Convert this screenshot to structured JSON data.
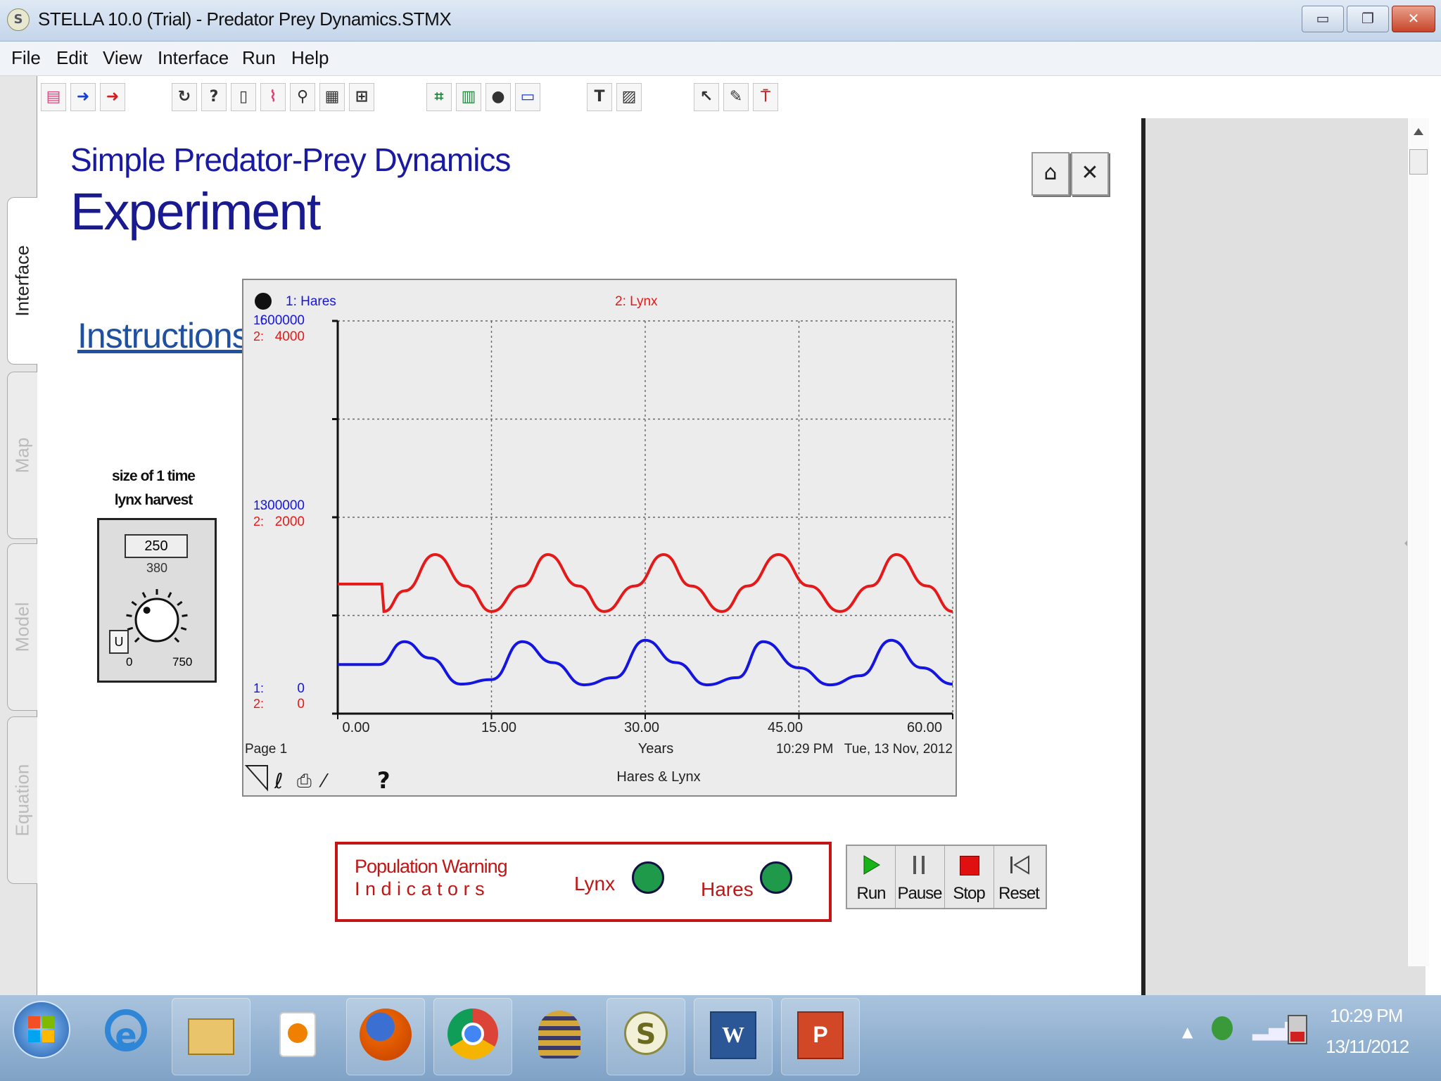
{
  "window": {
    "title": "STELLA 10.0 (Trial) - Predator Prey Dynamics.STMX",
    "app_icon": "S"
  },
  "menu": [
    "File",
    "Edit",
    "View",
    "Interface",
    "Run",
    "Help"
  ],
  "side_tabs": [
    "Interface",
    "Map",
    "Model",
    "Equation"
  ],
  "page": {
    "subtitle": "Simple Predator-Prey Dynamics",
    "title": "Experiment",
    "instructions_link": "Instructions"
  },
  "knob": {
    "label_line1": "size of 1 time",
    "label_line2": "lynx harvest",
    "display_value": "250",
    "dial_value": "380",
    "min": "0",
    "max": "750",
    "unit_button": "U",
    "level_fraction": 0.33
  },
  "chart_data": {
    "type": "line",
    "series_labels": [
      "1: Hares",
      "2: Lynx"
    ],
    "series": [
      {
        "name": "1: Hares",
        "color": "#1515e0",
        "axis_ticks": [
          "600000",
          "300000",
          "0"
        ],
        "ylim": [
          0,
          600000
        ],
        "points": [
          [
            0,
            75000
          ],
          [
            4,
            75000
          ],
          [
            6.5,
            110000
          ],
          [
            9,
            85000
          ],
          [
            12,
            45000
          ],
          [
            15,
            52000
          ],
          [
            18,
            110000
          ],
          [
            21,
            78000
          ],
          [
            24,
            44000
          ],
          [
            27,
            55000
          ],
          [
            30,
            112000
          ],
          [
            33,
            78000
          ],
          [
            36,
            44000
          ],
          [
            39,
            55000
          ],
          [
            41.5,
            110000
          ],
          [
            45,
            70000
          ],
          [
            48,
            44000
          ],
          [
            51,
            58000
          ],
          [
            54,
            112000
          ],
          [
            57,
            70000
          ],
          [
            60,
            45000
          ]
        ]
      },
      {
        "name": "2: Lynx",
        "color": "#e41a1a",
        "axis_ticks": [
          "4000",
          "2000",
          "0"
        ],
        "ylim": [
          0,
          4000
        ],
        "points": [
          [
            0,
            1320
          ],
          [
            4.3,
            1320
          ],
          [
            4.5,
            1040
          ],
          [
            6.5,
            1250
          ],
          [
            9.5,
            1620
          ],
          [
            12.5,
            1300
          ],
          [
            15,
            1040
          ],
          [
            18,
            1300
          ],
          [
            20.5,
            1620
          ],
          [
            23.5,
            1300
          ],
          [
            26,
            1040
          ],
          [
            29,
            1300
          ],
          [
            31.8,
            1620
          ],
          [
            34.5,
            1300
          ],
          [
            37.5,
            1040
          ],
          [
            40,
            1300
          ],
          [
            43,
            1620
          ],
          [
            46,
            1300
          ],
          [
            49,
            1040
          ],
          [
            52,
            1300
          ],
          [
            54.5,
            1620
          ],
          [
            57.5,
            1300
          ],
          [
            60,
            1040
          ]
        ]
      }
    ],
    "x_ticks": [
      "0.00",
      "15.00",
      "30.00",
      "45.00",
      "60.00"
    ],
    "xlim": [
      0,
      60
    ],
    "xlabel": "Years",
    "page_label": "Page 1",
    "timestamp": "10:29 PM   Tue, 13 Nov, 2012",
    "graph_title": "Hares & Lynx",
    "grid": true
  },
  "warning": {
    "line1": "Population Warning",
    "line2": "I n d i c a t o r s",
    "lynx_label": "Lynx",
    "hares_label": "Hares",
    "indicator_color": "#1f9a4a"
  },
  "run_controls": [
    "Run",
    "Pause",
    "Stop",
    "Reset"
  ],
  "taskbar": {
    "time": "10:29 PM",
    "date": "13/11/2012"
  }
}
